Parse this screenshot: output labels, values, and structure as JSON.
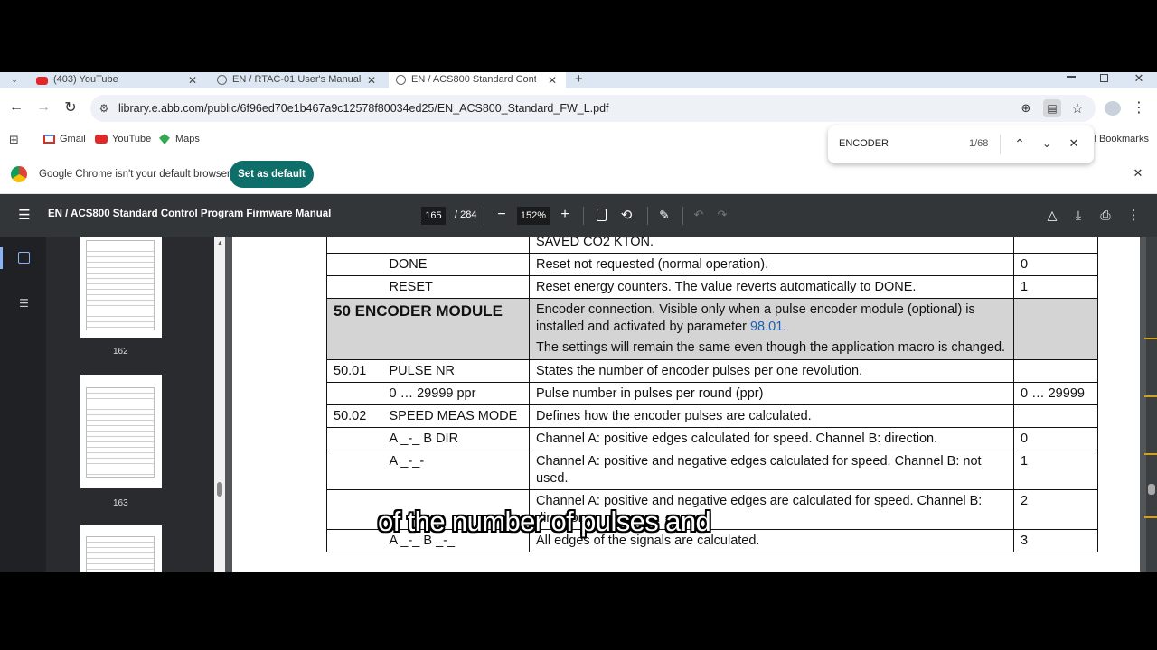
{
  "tabs": [
    {
      "title": "(403) YouTube",
      "close": "✕"
    },
    {
      "title": "EN / RTAC-01 User's Manual",
      "close": "✕"
    },
    {
      "title": "EN / ACS800 Standard Control",
      "close": "✕"
    }
  ],
  "new_tab": "+",
  "url": "library.e.abb.com/public/6f96ed70e1b467a9c12578f80034ed25/EN_ACS800_Standard_FW_L.pdf",
  "bookmarks": [
    {
      "label": "Gmail"
    },
    {
      "label": "YouTube"
    },
    {
      "label": "Maps"
    }
  ],
  "all_bookmarks": "ll Bookmarks",
  "find": {
    "query": "ENCODER",
    "count": "1/68"
  },
  "infobar": {
    "message": "Google Chrome isn't your default browser",
    "button": "Set as default"
  },
  "pdf": {
    "title": "EN / ACS800 Standard Control Program Firmware Manual",
    "page_current": "165",
    "page_total": "/ 284",
    "zoom": "152%"
  },
  "thumbnails": [
    {
      "label": "162"
    },
    {
      "label": "163"
    }
  ],
  "table": {
    "rows": [
      {
        "c1": "",
        "c2": "",
        "c3": "SAVED CO2 KTON.",
        "c4": ""
      },
      {
        "c1": "",
        "c2": "DONE",
        "c3": "Reset not requested (normal operation).",
        "c4": "0"
      },
      {
        "c1": "",
        "c2": "RESET",
        "c3": "Reset energy counters. The value reverts automatically to DONE.",
        "c4": "1"
      }
    ],
    "group": {
      "title": "50 ENCODER MODULE",
      "desc_a": "Encoder connection. Visible only when a pulse encoder module (optional) is installed and activated by parameter ",
      "desc_link": "98.01",
      "desc_end": ".",
      "desc_b": "The settings will remain the same even though the application macro is changed."
    },
    "rows2": [
      {
        "c1": "50.01",
        "c2": "PULSE NR",
        "c3": "States the number of encoder pulses per one revolution.",
        "c4": ""
      },
      {
        "c1": "",
        "c2": "0 … 29999 ppr",
        "c3": "Pulse number in pulses per round (ppr)",
        "c4": "0 … 29999"
      },
      {
        "c1": "50.02",
        "c2": "SPEED MEAS MODE",
        "c3": "Defines how the encoder pulses are calculated.",
        "c4": ""
      },
      {
        "c1": "",
        "c2": "A _-_ B DIR",
        "c3": "Channel A: positive edges calculated for speed. Channel B: direction.",
        "c4": "0"
      },
      {
        "c1": "",
        "c2": "A _-_-",
        "c3": "Channel A: positive and negative edges calculated for speed. Channel B: not used.",
        "c4": "1"
      },
      {
        "c1": "",
        "c2": "",
        "c3": "Channel A: positive and negative edges are calculated for speed. Channel B: direction.",
        "c4": "2"
      },
      {
        "c1": "",
        "c2": "A _-_ B _-_",
        "c3": "All edges of the signals are calculated.",
        "c4": "3"
      }
    ]
  },
  "subtitle": "of the number of pulses and"
}
